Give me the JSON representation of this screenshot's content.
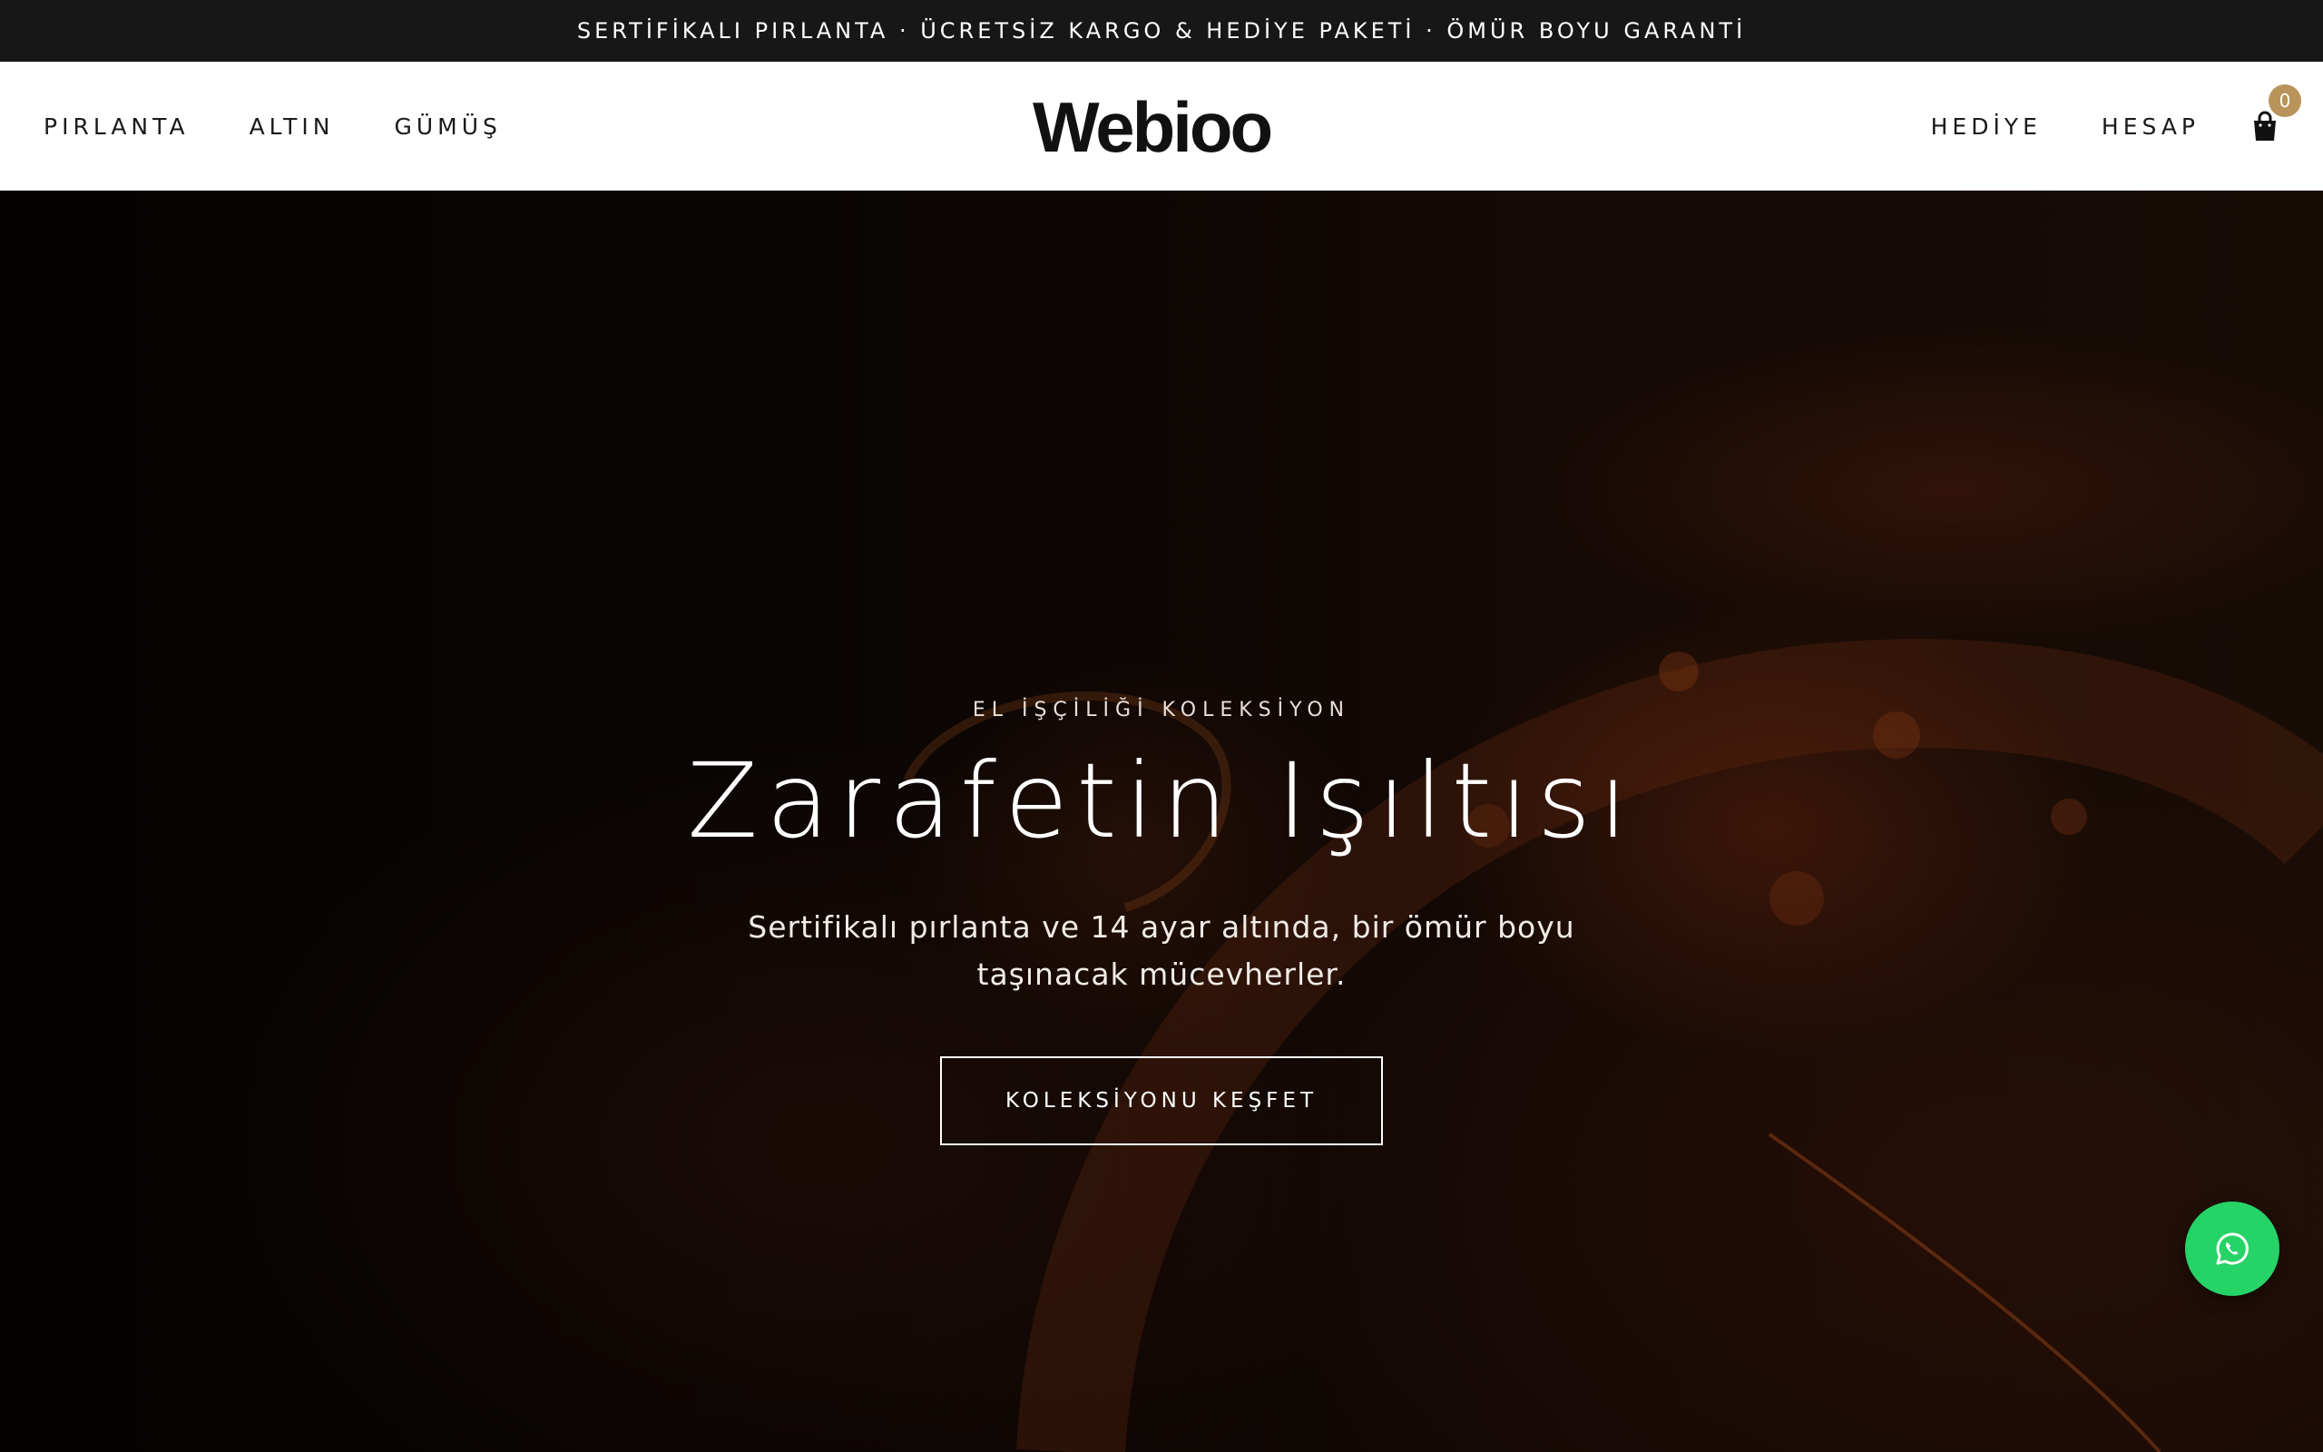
{
  "announcement": {
    "text": "SERTİFİKALI PIRLANTA · ÜCRETSİZ KARGO & HEDİYE PAKETİ · ÖMÜR BOYU GARANTİ"
  },
  "header": {
    "logo_text": "Webioo",
    "nav_left": [
      {
        "label": "PIRLANTA"
      },
      {
        "label": "ALTIN"
      },
      {
        "label": "GÜMÜŞ"
      }
    ],
    "nav_right": [
      {
        "label": "HEDİYE"
      },
      {
        "label": "HESAP"
      }
    ],
    "cart": {
      "icon": "shopping-bag-icon",
      "count": "0"
    }
  },
  "hero": {
    "eyebrow": "EL İŞÇİLİĞİ KOLEKSİYON",
    "title": "Zarafetin Işıltısı",
    "subtitle": "Sertifikalı pırlanta ve 14 ayar altında, bir ömür boyu taşınacak mücevherler.",
    "cta_label": "KOLEKSİYONU KEŞFET"
  },
  "floating": {
    "whatsapp_icon": "whatsapp-icon"
  },
  "colors": {
    "announcement_bg": "#171717",
    "header_bg": "#ffffff",
    "accent_gold": "#b8935a",
    "whatsapp_green": "#25d366"
  }
}
